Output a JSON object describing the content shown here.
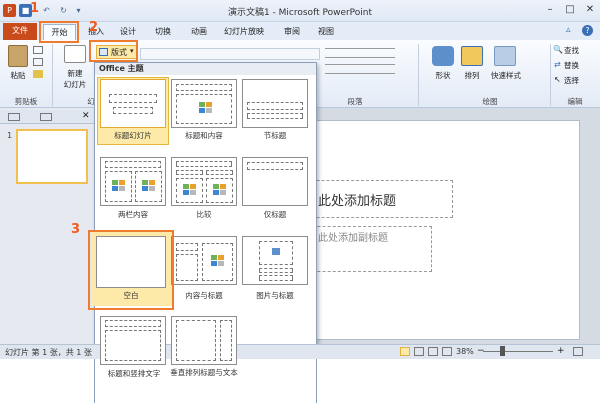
{
  "window": {
    "title": "演示文稿1 - Microsoft PowerPoint"
  },
  "tabs": [
    {
      "label": "文件"
    },
    {
      "label": "开始"
    },
    {
      "label": "插入"
    },
    {
      "label": "设计"
    },
    {
      "label": "切换"
    },
    {
      "label": "动画"
    },
    {
      "label": "幻灯片放映"
    },
    {
      "label": "审阅"
    },
    {
      "label": "视图"
    }
  ],
  "ribbon": {
    "paste": "粘贴",
    "new_slide": "新建",
    "new_slide_2": "幻灯片",
    "layout_btn": "版式",
    "shape": "形状",
    "arrange": "排列",
    "quick_style": "快速样式",
    "find": "查找",
    "replace": "替换",
    "select": "选择",
    "groups": {
      "clipboard": "剪贴板",
      "slides": "幻",
      "paragraph": "段落",
      "drawing": "绘图",
      "editing": "编辑"
    }
  },
  "dropdown": {
    "header": "Office 主题",
    "layouts": [
      "标题幻灯片",
      "标题和内容",
      "节标题",
      "两栏内容",
      "比较",
      "仅标题",
      "空白",
      "内容与标题",
      "图片与标题",
      "标题和竖排文字",
      "垂直排列标题与文本"
    ]
  },
  "slides_panel": {
    "slide_number": "1"
  },
  "slide": {
    "title_placeholder": "此处添加标题",
    "subtitle_placeholder": "此处添加副标题"
  },
  "annotations": {
    "a1": "1",
    "a2": "2",
    "a3": "3"
  },
  "status": {
    "left": "幻灯片 第 1 张，共 1 张",
    "zoom": "38%"
  },
  "colors": {
    "file_tab": "#c94a1a",
    "highlight": "#ef7b2e",
    "selected_tile": "#fde9a8"
  }
}
